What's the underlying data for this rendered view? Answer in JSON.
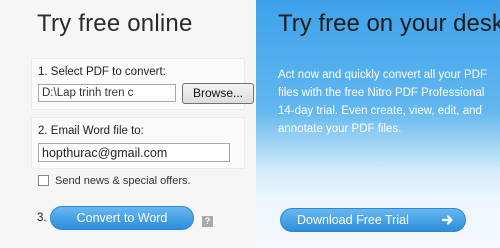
{
  "left": {
    "title": "Try free online",
    "step1": {
      "label": "1. Select PDF to convert:",
      "file_value": "D:\\Lap trinh tren c",
      "browse_label": "Browse..."
    },
    "step2": {
      "label": "2. Email Word file to:",
      "email_value": "hopthurac@gmail.com"
    },
    "news": {
      "label": "Send news & special offers.",
      "checked": false
    },
    "step3": {
      "number": "3.",
      "convert_label": "Convert to Word",
      "help_glyph": "?"
    }
  },
  "right": {
    "title": "Try free on your desk",
    "body": "Act now and quickly convert all your PDF files with the free Nitro PDF Professional 14-day trial. Even create, view, edit, and annotate your PDF files.",
    "download_label": "Download Free Trial",
    "download_icon": "arrow-right-icon"
  },
  "colors": {
    "accent": "#2c8ddc",
    "panel_blue": "#3ea2ea"
  }
}
